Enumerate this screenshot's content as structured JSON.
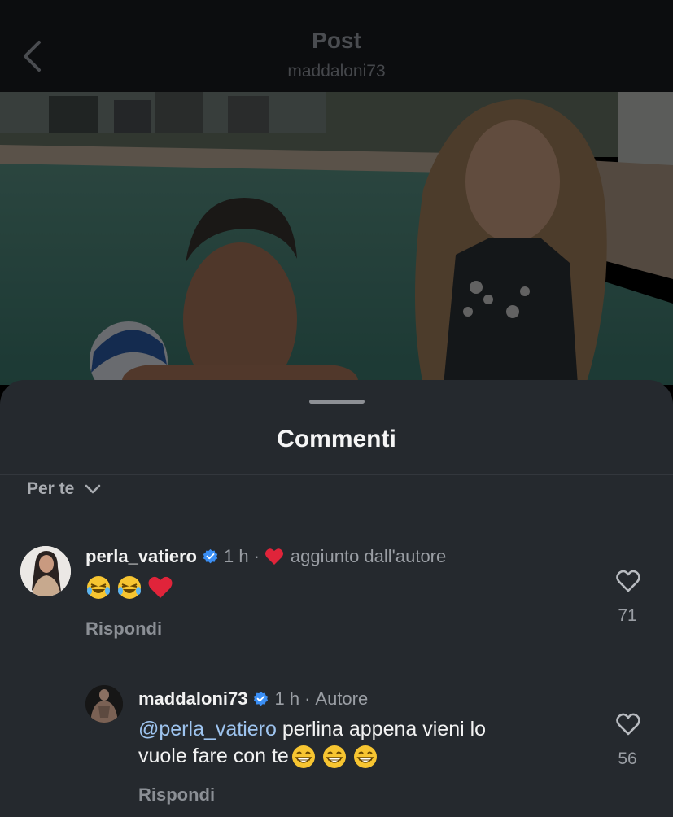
{
  "header": {
    "title": "Post",
    "username": "maddaloni73"
  },
  "sheet": {
    "title": "Commenti",
    "sort_label": "Per te"
  },
  "comments": [
    {
      "username": "perla_vatiero",
      "verified": true,
      "time": "1 h",
      "separator": "·",
      "liked_by_author_label": "aggiunto dall'autore",
      "emojis": [
        "laughing-tears-emoji",
        "laughing-tears-emoji",
        "red-heart-emoji"
      ],
      "reply_label": "Rispondi",
      "likes": "71"
    },
    {
      "username": "maddaloni73",
      "verified": true,
      "time": "1 h",
      "separator": "·",
      "author_label": "Autore",
      "mention": "@perla_vatiero",
      "text_line1": " perlina appena vieni lo",
      "text_line2": "vuole fare con te",
      "emojis": [
        "grinning-emoji",
        "grinning-emoji",
        "grinning-emoji"
      ],
      "reply_label": "Rispondi",
      "likes": "56"
    }
  ],
  "colors": {
    "sheet_bg": "#25292e",
    "mention": "#9ec4ef",
    "verified": "#3b8ff5",
    "heart": "#e0243a"
  }
}
